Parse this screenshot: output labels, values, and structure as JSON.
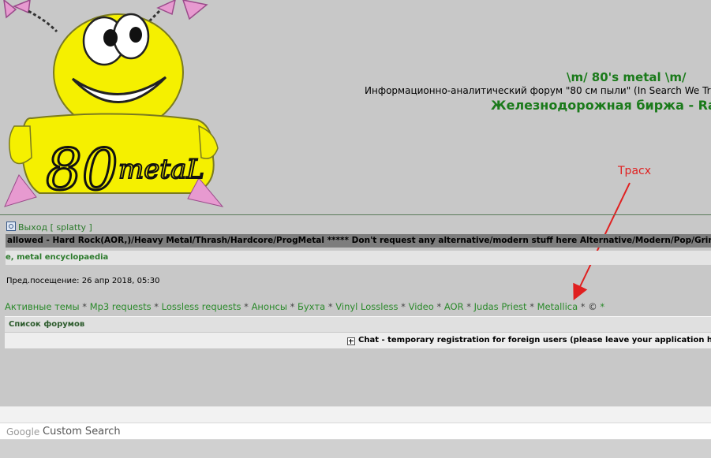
{
  "header": {
    "site_title": "\\m/ 80's metal \\m/",
    "site_description": "Информационно-аналитический форум \"80 см пыли\" (In Search We Tr",
    "site_subtitle": "Железнодорожная биржа - Ra",
    "logo_text": "80 metaL"
  },
  "annotation": {
    "label": "Трасх",
    "color": "#e02020"
  },
  "user_bar": {
    "logout_label": "Выход",
    "username_bracket_open": "[",
    "username": "splatty",
    "username_bracket_close": "]"
  },
  "ticker": {
    "text": "allowed - Hard Rock(AOR,)/Heavy Metal/Thrash/Hardcore/ProgMetal ***** Don't request any alternative/modern stuff here Alternative/Modern/Pop/Grind"
  },
  "encyclopaedia": {
    "text": "e, metal encyclopaedia"
  },
  "last_visit": {
    "text": "Пред.посещение: 26 апр 2018, 05:30"
  },
  "nav": {
    "items": [
      "Активные темы",
      "Mp3 requests",
      "Lossless requests",
      "Анонсы",
      "Бухта",
      "Vinyl Lossless",
      "Video",
      "AOR",
      "Judas Priest",
      "Metallica"
    ],
    "separator": "*",
    "copyright": "©",
    "trailing": "*"
  },
  "forum_list": {
    "header": "Список форумов",
    "rows": [
      {
        "title": "Chat - temporary registration for foreign users (please leave your application here)"
      }
    ]
  },
  "search": {
    "google_label": "Google",
    "placeholder": "Custom Search"
  },
  "colors": {
    "page_bg": "#c8c8c8",
    "link_green": "#2b8a2b",
    "title_green": "#1a7a1a",
    "mascot_yellow": "#f5f000"
  }
}
